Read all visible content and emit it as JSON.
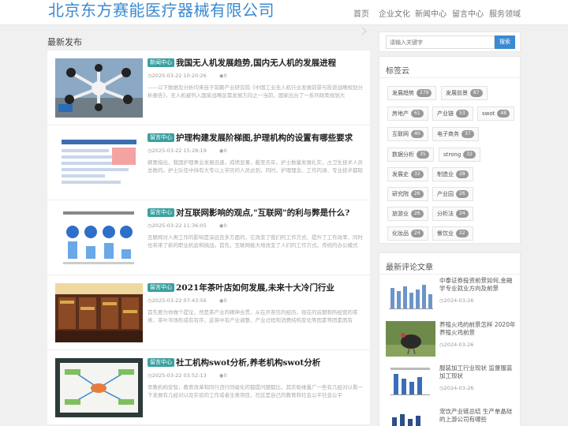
{
  "header": {
    "site_title": "北京东方赛能医疗器械有限公司",
    "nav": [
      "首页",
      "企业文化",
      "新闻中心",
      "留言中心",
      "服务领域"
    ]
  },
  "main": {
    "section_title": "最新发布",
    "posts": [
      {
        "tag": "新闻中心",
        "title": "我国无人机发展趋势,国内无人机的发展进程",
        "date": "2025-03-22 10:20:26",
        "views": "0",
        "excerpt": "——以下数据及分析均来自于前瞻产业研究院《中国工业无人机行业发展前景与投资战略规划分析报告》，无人机被列入国家战略急需发展方向之一当前，国家出台了一系列政策规划大"
      },
      {
        "tag": "留言中心",
        "title": "护理构建发展阶梯图,护理机构的设置有哪些要求",
        "date": "2025-03-22 15:28:19",
        "views": "0",
        "excerpt": "纲要指出，我国护理事业发展迅速，成绩显著，截至去年，护士数量发展扎实，占卫生技术人员总数的。护士队伍中持有大专以上学历的人员达到，同时，护理理念、工作内涵、专业技术都取"
      },
      {
        "tag": "留言中心",
        "title": "对互联网影响的观点,\"互联网\"的利与弊是什么?",
        "date": "2025-03-22 11:36:05",
        "views": "0",
        "excerpt": "互联网对人类工作的影响是深远且多方面的，它改变了我们的工作方式、提升了工作效率、同时也带来了新的职业机会和挑战。首先，互联网极大地改变了人们的工作方式。传统的办公模式"
      },
      {
        "tag": "留言中心",
        "title": "2021年茶叶店如何发展,未来十大冷门行业",
        "date": "2025-03-22 07:43:56",
        "views": "0",
        "excerpt": "首先要为你做个提论，然是茶产业的精神合贯，从在开茶信的经历，现在的店期和所经营的茶类，茶叶市场形成有有序，这将中有产业调整，产业过程和消费结构变化等因素等因素而有"
      },
      {
        "tag": "留言中心",
        "title": "社工机构swot分析,养老机构swot分析",
        "date": "2025-03-22 03:52:13",
        "views": "0",
        "excerpt": "早教机构安智，教育改革和同行违行同级化的都提问题都比，其实助维量广一些有几经对以看一下发展有几经对以及实验的工作或者生意项目，社区是自己的教育和社会公平社会公平"
      }
    ]
  },
  "sidebar": {
    "search": {
      "placeholder": "请输入关键字",
      "button": "搜索"
    },
    "tag_cloud_title": "标签云",
    "tags": [
      {
        "name": "发展趋势",
        "count": "279"
      },
      {
        "name": "发展前景",
        "count": "87"
      },
      {
        "name": "房地产",
        "count": "61"
      },
      {
        "name": "产业链",
        "count": "53"
      },
      {
        "name": "swot",
        "count": "48"
      },
      {
        "name": "互联网",
        "count": "40"
      },
      {
        "name": "电子商务",
        "count": "37"
      },
      {
        "name": "数据分析",
        "count": "35"
      },
      {
        "name": "strong",
        "count": "32"
      },
      {
        "name": "发展史",
        "count": "32"
      },
      {
        "name": "制造业",
        "count": "28"
      },
      {
        "name": "研究院",
        "count": "26"
      },
      {
        "name": "产业园",
        "count": "26"
      },
      {
        "name": "旅游业",
        "count": "26"
      },
      {
        "name": "分析法",
        "count": "24"
      },
      {
        "name": "化妆品",
        "count": "24"
      },
      {
        "name": "餐饮业",
        "count": "22"
      }
    ],
    "latest_title": "最新评论文章",
    "latest": [
      {
        "title": "中泰证券投资前景如何,金融学专业就业方向及前景",
        "date": "2024-03-26"
      },
      {
        "title": "养殖火鸡的前景怎样 2020年养殖火鸡前景",
        "date": "2024-03-26"
      },
      {
        "title": "服装加工行业现状 监督服装加工现状",
        "date": "2024-03-26"
      },
      {
        "title": "宠饮产业链总结 生产单晶硅的上游公司有哪些",
        "date": ""
      }
    ]
  },
  "colors": {
    "accent": "#3a8ad0",
    "tag_green": "#3ca0a0",
    "badge_gray": "#999999"
  }
}
